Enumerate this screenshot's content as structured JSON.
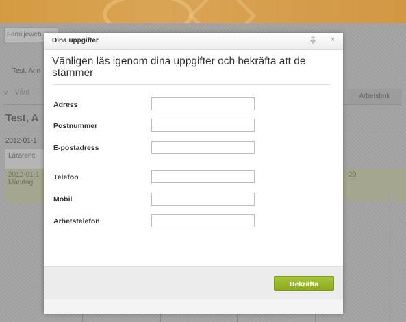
{
  "background": {
    "tab_label": "Familjeweb",
    "user_label": "Test. Ann",
    "nav_items": [
      "v",
      "Vård"
    ],
    "nav_right": "Arbetsbok",
    "page_name": "Test, A",
    "date": "2012-01-1",
    "cell_label": "Lärarens",
    "day_date": "2012-01-1",
    "day_name": "Måndag",
    "right_cell": "-20"
  },
  "dialog": {
    "title": "Dina uppgifter",
    "pin_icon": "pin-icon",
    "close_icon": "×",
    "heading": "Vänligen läs igenom dina uppgifter och bekräfta att de stämmer",
    "fields": [
      {
        "label": "Adress",
        "value": ""
      },
      {
        "label": "Postnummer",
        "value": ""
      },
      {
        "label": "E-postadress",
        "value": ""
      },
      {
        "label": "Telefon",
        "value": ""
      },
      {
        "label": "Mobil",
        "value": ""
      },
      {
        "label": "Arbetstelefon",
        "value": ""
      }
    ],
    "confirm_label": "Bekräfta"
  },
  "colors": {
    "banner": "#dca551",
    "confirm_button": "#9ab62a"
  }
}
